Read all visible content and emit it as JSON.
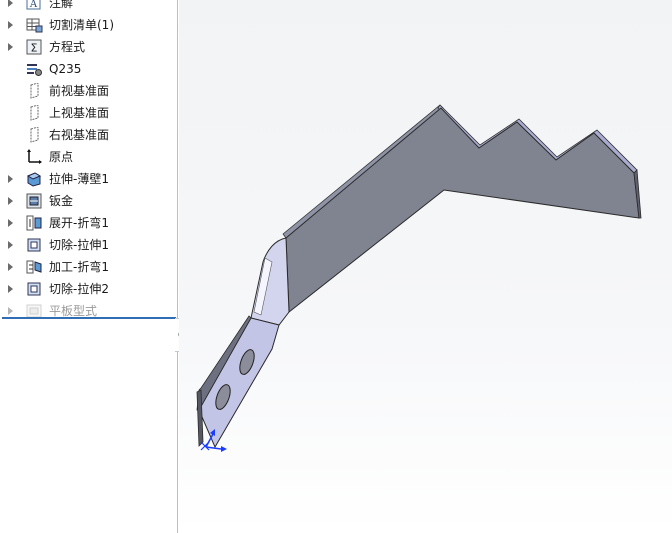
{
  "feature_tree": {
    "items": [
      {
        "label": "注解",
        "icon": "annotation-icon",
        "expandable": true,
        "disabled": false
      },
      {
        "label": "切割清单(1)",
        "icon": "cut-list-icon",
        "expandable": true,
        "disabled": false
      },
      {
        "label": "方程式",
        "icon": "equations-icon",
        "expandable": true,
        "disabled": false
      },
      {
        "label": "Q235",
        "icon": "material-icon",
        "expandable": false,
        "disabled": false
      },
      {
        "label": "前视基准面",
        "icon": "plane-icon",
        "expandable": false,
        "disabled": false
      },
      {
        "label": "上视基准面",
        "icon": "plane-icon",
        "expandable": false,
        "disabled": false
      },
      {
        "label": "右视基准面",
        "icon": "plane-icon",
        "expandable": false,
        "disabled": false
      },
      {
        "label": "原点",
        "icon": "origin-icon",
        "expandable": false,
        "disabled": false
      },
      {
        "label": "拉伸-薄壁1",
        "icon": "extrude-thin-icon",
        "expandable": true,
        "disabled": false
      },
      {
        "label": "钣金",
        "icon": "sheet-metal-icon",
        "expandable": true,
        "disabled": false
      },
      {
        "label": "展开-折弯1",
        "icon": "unfold-icon",
        "expandable": true,
        "disabled": false
      },
      {
        "label": "切除-拉伸1",
        "icon": "cut-extrude-icon",
        "expandable": true,
        "disabled": false
      },
      {
        "label": "加工-折弯1",
        "icon": "fold-icon",
        "expandable": true,
        "disabled": false
      },
      {
        "label": "切除-拉伸2",
        "icon": "cut-extrude-icon",
        "expandable": true,
        "disabled": false
      },
      {
        "label": "平板型式",
        "icon": "flat-pattern-icon",
        "expandable": true,
        "disabled": true
      }
    ]
  },
  "colors": {
    "rollback_bar": "#2f6db5",
    "part_face_dark": "#7d8089",
    "part_face_light": "#c9cbe8",
    "axis_blue": "#1a3cff"
  }
}
